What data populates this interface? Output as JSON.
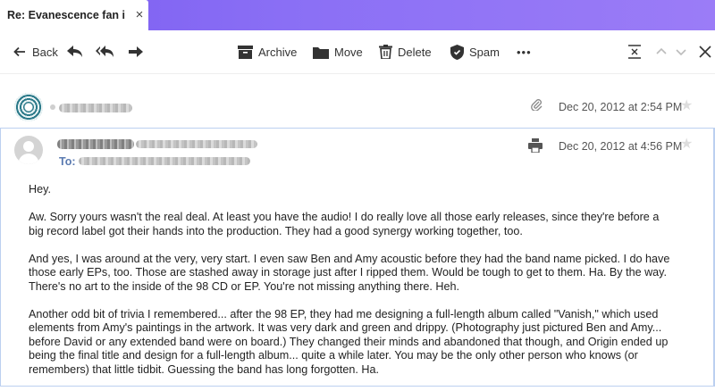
{
  "tab": {
    "title": "Re: Evanescence fan i",
    "close": "×"
  },
  "toolbar": {
    "back_label": "Back",
    "archive_label": "Archive",
    "move_label": "Move",
    "delete_label": "Delete",
    "spam_label": "Spam",
    "more_label": "•••"
  },
  "messages": {
    "collapsed_date": "Dec 20, 2012 at 2:54 PM",
    "open_date": "Dec 20, 2012 at 4:56 PM",
    "to_label": "To:"
  },
  "body": {
    "paragraphs": [
      "Hey.",
      "Aw.  Sorry yours wasn't the real deal.  At least you have the audio!  I do really love all those early releases, since they're before a\nbig record label got their hands into the production.  They had a good synergy working together, too.",
      "And yes, I was around at the very, very start.  I even saw Ben and Amy acoustic before they had the band name picked.  I do have\nthose early EPs, too.  Those are stashed away in storage just after I ripped them.  Would be tough to get to them.  Ha.  By the way.\n There's no art to the inside of the 98 CD or EP.  You're not missing anything there.  Heh.",
      "Another odd bit of trivia I remembered...   after the 98 EP, they had me designing a full-length album called \"Vanish,\" which used\nelements from Amy's paintings in the artwork.  It was very dark and green and drippy.  (Photography just pictured Ben and Amy...\nbefore David or any extended band were on board.)  They changed their minds and abandoned that though, and Origin ended up\nbeing the final title and design for a full-length album... quite a while later.  You may be the only other person who knows (or\nremembers) that little tidbit.  Guessing the band has long forgotten.  Ha."
    ]
  }
}
